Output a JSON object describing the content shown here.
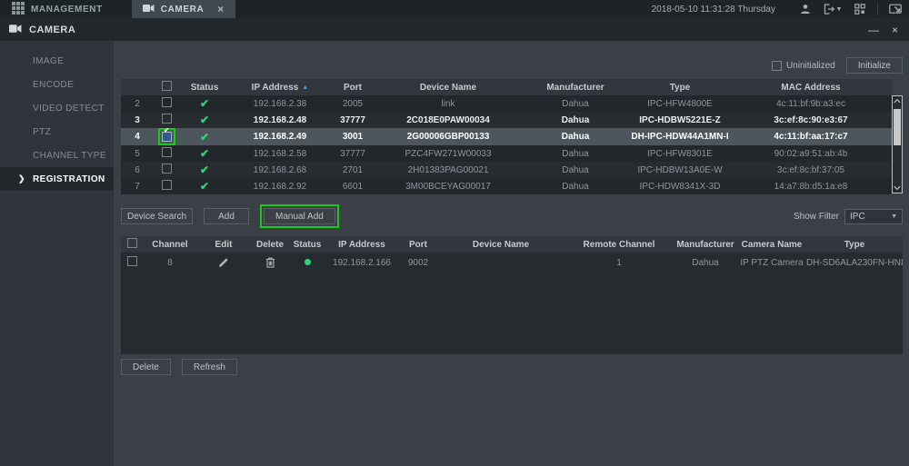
{
  "topbar": {
    "management_tab": "MANAGEMENT",
    "camera_tab": "CAMERA",
    "close_tab": "×",
    "datetime": "2018-05-10 11:31:28 Thursday"
  },
  "window": {
    "title": "CAMERA",
    "minimize": "—",
    "close": "×"
  },
  "sidebar": {
    "items": [
      {
        "label": "IMAGE"
      },
      {
        "label": "ENCODE"
      },
      {
        "label": "VIDEO DETECT"
      },
      {
        "label": "PTZ"
      },
      {
        "label": "CHANNEL TYPE"
      },
      {
        "label": "REGISTRATION",
        "active": true
      }
    ],
    "active_arrow": "❯"
  },
  "discovery": {
    "uninitialized_label": "Uninitialized",
    "initialize_button": "Initialize",
    "headers": {
      "status": "Status",
      "ip": "IP Address",
      "port": "Port",
      "device": "Device Name",
      "manufacturer": "Manufacturer",
      "type": "Type",
      "mac": "MAC Address"
    },
    "sort_icon_glyph": "▲",
    "check_glyph": "✔",
    "rows": [
      {
        "num": "2",
        "checked": false,
        "ip": "192.168.2.38",
        "port": "2005",
        "device": "link",
        "manufacturer": "Dahua",
        "type": "IPC-HFW4800E",
        "mac": "4c:11:bf:9b:a3:ec"
      },
      {
        "num": "3",
        "checked": false,
        "ip": "192.168.2.48",
        "port": "37777",
        "device": "2C018E0PAW00034",
        "manufacturer": "Dahua",
        "type": "IPC-HDBW5221E-Z",
        "mac": "3c:ef:8c:90:e3:67"
      },
      {
        "num": "4",
        "checked": true,
        "selected": true,
        "ip": "192.168.2.49",
        "port": "3001",
        "device": "2G00006GBP00133",
        "manufacturer": "Dahua",
        "type": "DH-IPC-HDW44A1MN-I",
        "mac": "4c:11:bf:aa:17:c7"
      },
      {
        "num": "5",
        "checked": false,
        "ip": "192.168.2.58",
        "port": "37777",
        "device": "PZC4FW271W00033",
        "manufacturer": "Dahua",
        "type": "IPC-HFW8301E",
        "mac": "90:02:a9:51:ab:4b"
      },
      {
        "num": "6",
        "checked": false,
        "ip": "192.168.2.68",
        "port": "2701",
        "device": "2H01383PAG00021",
        "manufacturer": "Dahua",
        "type": "IPC-HDBW13A0E-W",
        "mac": "3c:ef:8c:bf:37:05"
      },
      {
        "num": "7",
        "checked": false,
        "ip": "192.168.2.92",
        "port": "6601",
        "device": "3M00BCEYAG00017",
        "manufacturer": "Dahua",
        "type": "IPC-HDW8341X-3D",
        "mac": "14:a7:8b:d5:1a:e8"
      }
    ]
  },
  "toolbar": {
    "device_search": "Device Search",
    "add": "Add",
    "manual_add": "Manual Add",
    "show_filter_label": "Show Filter",
    "filter_value": "IPC",
    "dropdown_glyph": "▼"
  },
  "added": {
    "headers": {
      "channel": "Channel",
      "edit": "Edit",
      "delete": "Delete",
      "status": "Status",
      "ip": "IP Address",
      "port": "Port",
      "device": "Device Name",
      "remote": "Remote Channel",
      "manufacturer": "Manufacturer",
      "camera": "Camera Name",
      "type": "Type"
    },
    "rows": [
      {
        "channel": "8",
        "ip": "192.168.2.166",
        "port": "9002",
        "device": "",
        "remote": "1",
        "manufacturer": "Dahua",
        "camera": "IP PTZ Camera",
        "type": "DH-SD6ALA230FN-HNI"
      }
    ]
  },
  "footer": {
    "delete_button": "Delete",
    "refresh_button": "Refresh"
  }
}
